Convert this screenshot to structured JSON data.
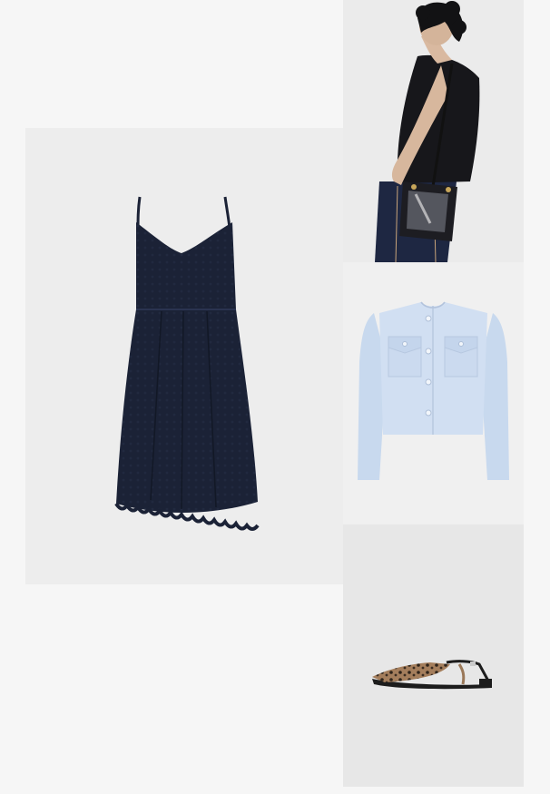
{
  "products": [
    {
      "id": "dress",
      "name": "navy-lace-dress"
    },
    {
      "id": "bag",
      "name": "model-with-bucket-bag"
    },
    {
      "id": "jacket",
      "name": "light-blue-jacket"
    },
    {
      "id": "shoes",
      "name": "leopard-slingback-flats"
    }
  ],
  "colors": {
    "page_bg": "#f6f6f6",
    "dress": "#1b2236",
    "jacket": "#cddcf0",
    "bag": "#1d1d22",
    "leopard": "#9b7656"
  }
}
